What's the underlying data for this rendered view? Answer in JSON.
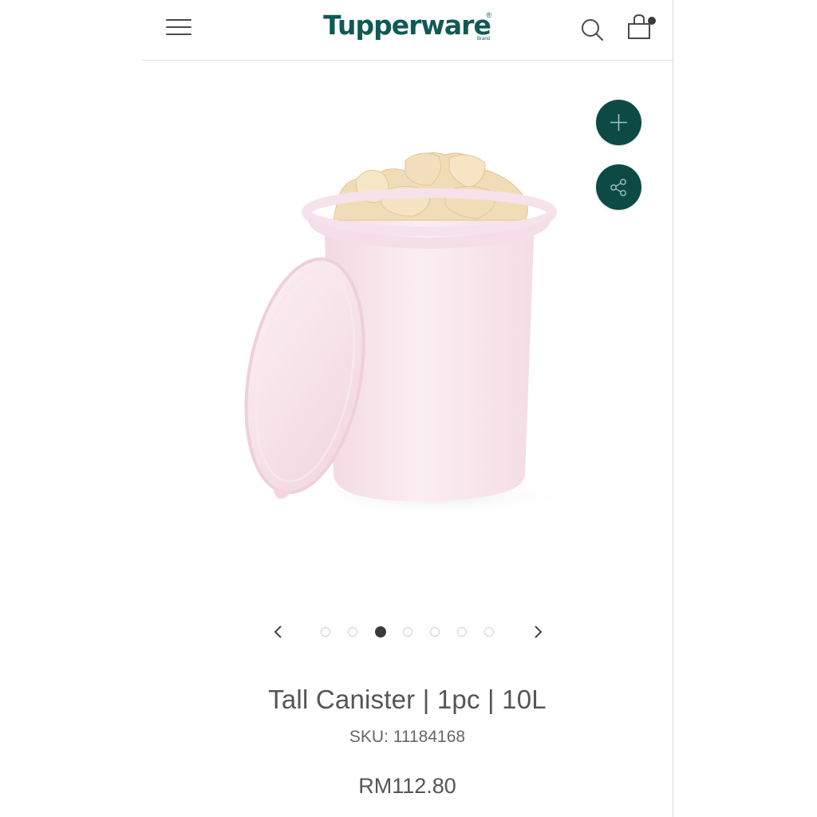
{
  "header": {
    "brand": "Tupperware",
    "brand_mark": "®",
    "brand_sub": "Brand",
    "menu_icon": "hamburger-menu-icon",
    "search_icon": "search-icon",
    "cart_icon": "shopping-bag-icon"
  },
  "product": {
    "title": "Tall Canister | 1pc | 10L",
    "sku": "SKU: 11184168",
    "price": "RM112.80",
    "image_alt": "Pink tall canister with lid, filled with crackers"
  },
  "actions": {
    "add_icon": "plus-icon",
    "share_icon": "share-icon"
  },
  "carousel": {
    "total": 7,
    "active_index": 2,
    "prev_icon": "chevron-left-icon",
    "next_icon": "chevron-right-icon"
  },
  "colors": {
    "brand_green": "#0e4a45",
    "text_gray": "#555555"
  }
}
